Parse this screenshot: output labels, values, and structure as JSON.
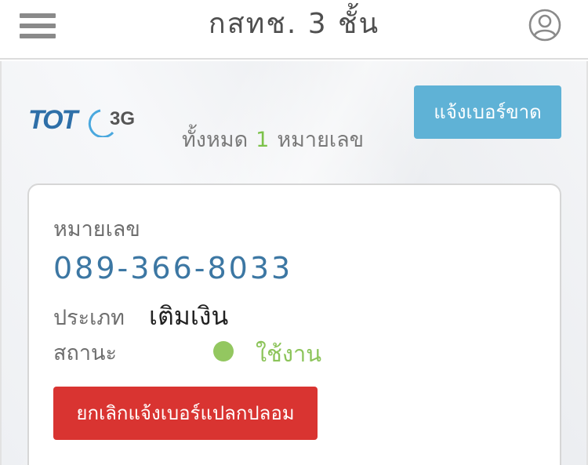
{
  "header": {
    "title": "กสทช. 3 ชั้น",
    "menu_icon": "hamburger-menu-icon",
    "profile_icon": "user-profile-icon"
  },
  "brand": {
    "logo_text": "TOT",
    "logo_suffix": "3G"
  },
  "summary": {
    "prefix": "ทั้งหมด",
    "count": "1",
    "suffix": "หมายเลข"
  },
  "actions": {
    "report_label": "แจ้งเบอร์ขาด"
  },
  "card": {
    "number_label": "หมายเลข",
    "number_value": "089-366-8033",
    "type_label": "ประเภท",
    "type_value": "เติมเงิน",
    "status_label": "สถานะ",
    "status_value": "ใช้งาน",
    "cancel_label": "ยกเลิกแจ้งเบอร์แปลกปลอม"
  },
  "colors": {
    "report_button": "#5fb2d6",
    "cancel_button": "#d93431",
    "phone_text": "#3c77a3",
    "status_active": "#8cc45a"
  }
}
